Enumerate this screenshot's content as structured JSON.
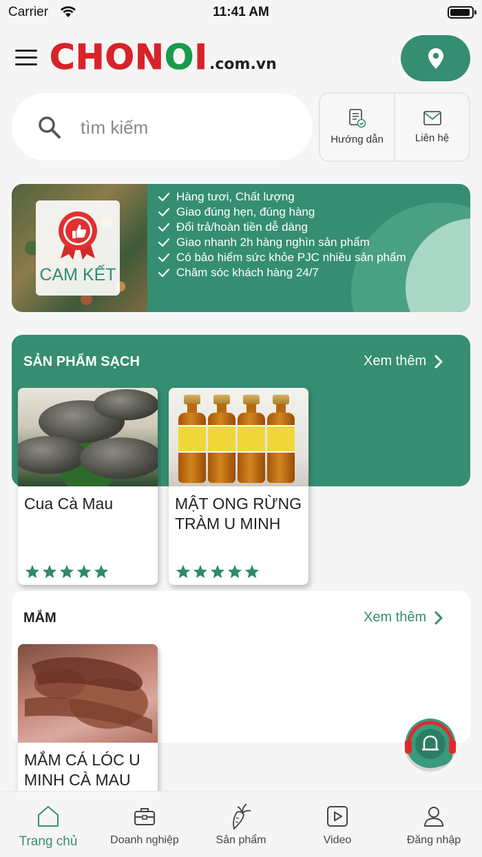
{
  "status_bar": {
    "carrier": "Carrier",
    "time": "11:41 AM"
  },
  "header": {
    "logo_main": "CHONOI",
    "logo_suffix": ".com.vn"
  },
  "search": {
    "placeholder": "tìm kiếm"
  },
  "quick_links": [
    {
      "label": "Hướng dẫn",
      "icon": "guide-document-icon"
    },
    {
      "label": "Liên hệ",
      "icon": "mail-icon"
    }
  ],
  "banner": {
    "badge_text": "CAM KẾT",
    "items": [
      "Hàng tươi, Chất lượng",
      "Giao đúng hẹn, đúng hàng",
      "Đổi trả/hoàn tiền dễ dàng",
      "Giao nhanh 2h hàng nghìn sản phẩm",
      "Có bảo hiểm sức khỏe PJC nhiều sản phẩm",
      "Chăm sóc khách hàng 24/7"
    ]
  },
  "sections": [
    {
      "title": "SẢN PHẨM SẠCH",
      "see_more": "Xem thêm",
      "products": [
        {
          "name": "Cua Cà Mau",
          "rating": 5
        },
        {
          "name": "MẬT ONG RỪNG TRÀM U MINH",
          "rating": 5
        }
      ]
    },
    {
      "title": "MẮM",
      "see_more": "Xem thêm",
      "products": [
        {
          "name": "MẮM CÁ LÓC U MINH CÀ MAU"
        }
      ]
    }
  ],
  "tab_bar": [
    {
      "label": "Trang chủ",
      "icon": "home-icon",
      "active": true
    },
    {
      "label": "Doanh nghiệp",
      "icon": "briefcase-icon",
      "active": false
    },
    {
      "label": "Sản phẩm",
      "icon": "carrot-icon",
      "active": false
    },
    {
      "label": "Video",
      "icon": "video-play-icon",
      "active": false
    },
    {
      "label": "Đăng nhập",
      "icon": "user-icon",
      "active": false
    }
  ],
  "colors": {
    "primary": "#358e72",
    "logo_red": "#d8232a",
    "logo_green": "#1a9b4b",
    "star": "#2f8a6e",
    "background": "#f5f5f5"
  }
}
